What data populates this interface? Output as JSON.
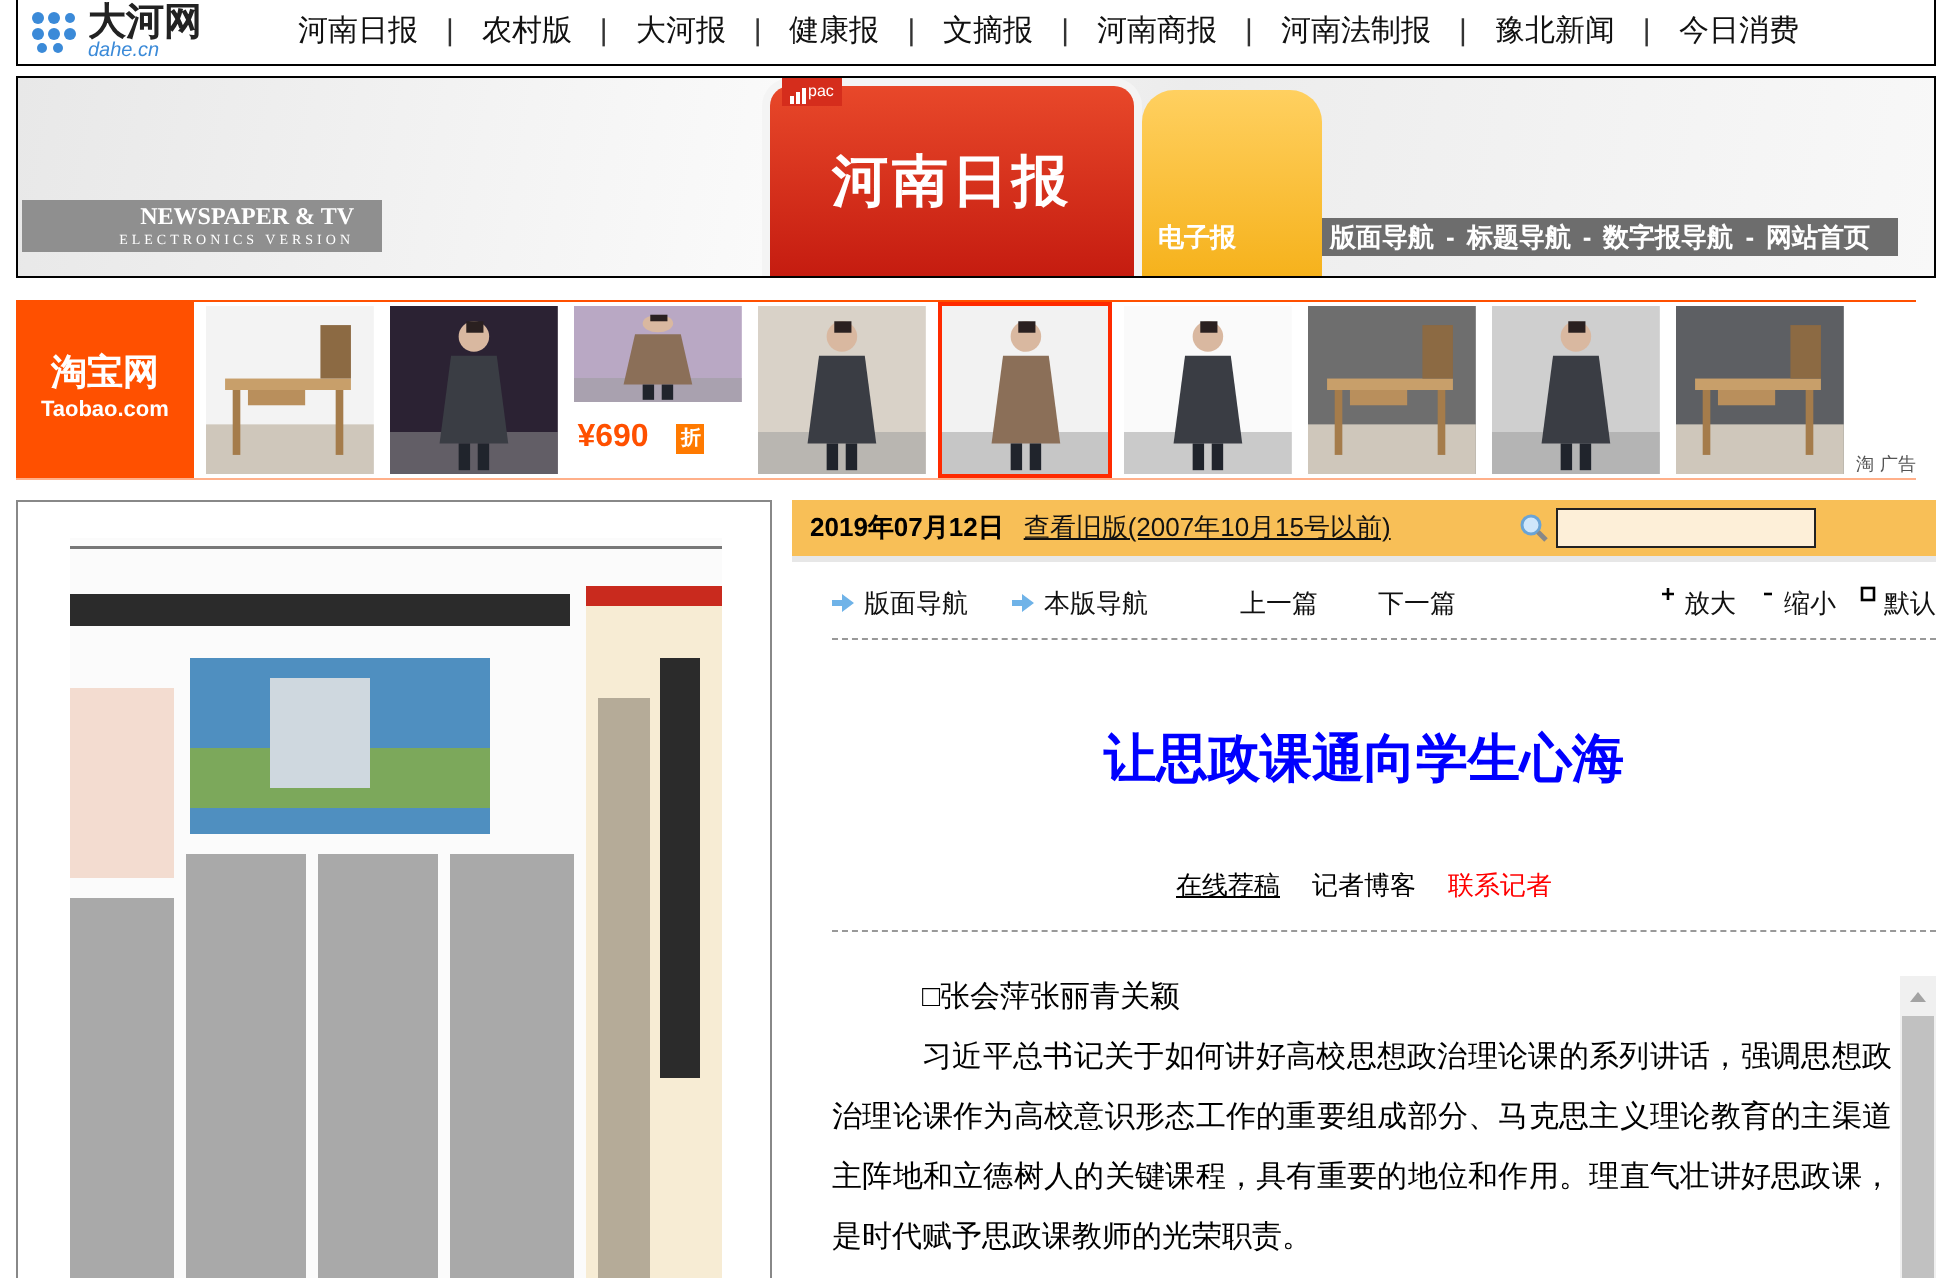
{
  "site_header": {
    "logo_text": "大河网",
    "logo_sub": "dahe.cn",
    "separator": "|",
    "nav": [
      {
        "label": "河南日报"
      },
      {
        "label": "农村版"
      },
      {
        "label": "大河报"
      },
      {
        "label": "健康报"
      },
      {
        "label": "文摘报"
      },
      {
        "label": "河南商报"
      },
      {
        "label": "河南法制报"
      },
      {
        "label": "豫北新闻"
      },
      {
        "label": "今日消费"
      }
    ]
  },
  "banner": {
    "tagline": "NEWSPAPER & TV",
    "tagline_sub": "ELECTRONICS VERSION",
    "tab_text": "pac",
    "title": "河南日报",
    "subtitle": "电子报",
    "separator": "-",
    "links": [
      {
        "label": "版面导航"
      },
      {
        "label": "标题导航"
      },
      {
        "label": "数字报导航"
      },
      {
        "label": "网站首页"
      }
    ]
  },
  "ad": {
    "logo": "淘宝网",
    "logo_sub": "Taobao.com",
    "ad_mark": "淘",
    "ad_label": "广告",
    "items": [
      {
        "kind": "desk",
        "highlighted": false
      },
      {
        "kind": "figure",
        "highlighted": false
      },
      {
        "kind": "price",
        "highlighted": false,
        "price": "¥690",
        "tag": "折"
      },
      {
        "kind": "figure",
        "highlighted": false
      },
      {
        "kind": "figure",
        "highlighted": true
      },
      {
        "kind": "figure",
        "highlighted": false
      },
      {
        "kind": "desk",
        "highlighted": false
      },
      {
        "kind": "figure",
        "highlighted": false
      },
      {
        "kind": "desk",
        "highlighted": false
      }
    ]
  },
  "article_bar": {
    "date": "2019年07月12日",
    "archive_link": "查看旧版(2007年10月15号以前)"
  },
  "toolbar": {
    "nav": [
      {
        "label": "版面导航"
      },
      {
        "label": "本版导航"
      }
    ],
    "pager": [
      {
        "label": "上一篇"
      },
      {
        "label": "下一篇"
      }
    ],
    "zoom": [
      {
        "kind": "plus",
        "label": "放大"
      },
      {
        "kind": "minus",
        "label": "缩小"
      },
      {
        "kind": "square",
        "label": "默认"
      }
    ]
  },
  "article": {
    "title": "让思政课通向学生心海",
    "actions": [
      {
        "kind": "link",
        "label": "在线荐稿"
      },
      {
        "kind": "plain",
        "label": "记者博客"
      },
      {
        "kind": "alert",
        "label": "联系记者"
      }
    ],
    "byline": "□张会萍张丽青关颖",
    "paragraphs": [
      "习近平总书记关于如何讲好高校思想政治理论课的系列讲话，强调思想政治理论课作为高校意识形态工作的重要组成部分、马克思主义理论教育的主渠道主阵地和立德树人的关键课程，具有重要的地位和作用。理直气壮讲好思政课，是时代赋予思政课教师的光荣职责。"
    ]
  }
}
